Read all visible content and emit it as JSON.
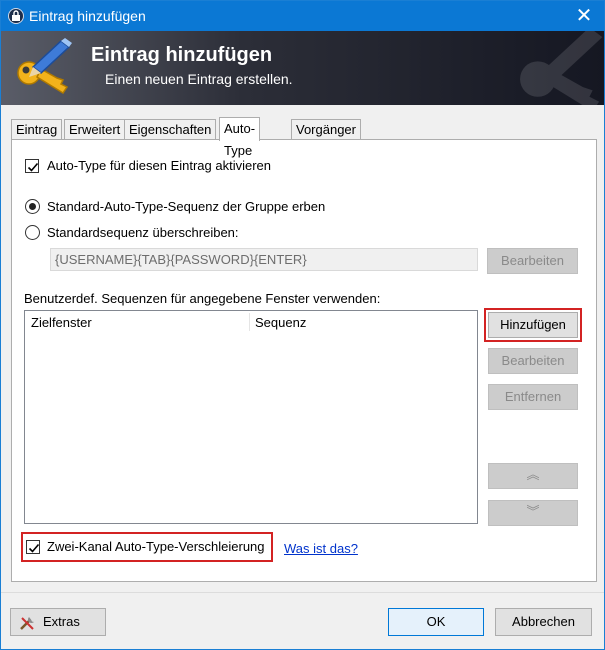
{
  "window": {
    "title": "Eintrag hinzufügen",
    "close_glyph": "✕"
  },
  "banner": {
    "title": "Eintrag hinzufügen",
    "subtitle": "Einen neuen Eintrag erstellen.",
    "icon": "key-pen-icon"
  },
  "tabs": [
    {
      "label": "Eintrag"
    },
    {
      "label": "Erweitert"
    },
    {
      "label": "Eigenschaften"
    },
    {
      "label": "Auto-Type"
    },
    {
      "label": "Vorgänger"
    }
  ],
  "active_tab": "Auto-Type",
  "autotype": {
    "enable_label": "Auto-Type für diesen Eintrag aktivieren",
    "enable_checked": true,
    "inherit_label": "Standard-Auto-Type-Sequenz der Gruppe erben",
    "inherit_selected": true,
    "override_label": "Standardsequenz überschreiben:",
    "override_selected": false,
    "sequence_value": "{USERNAME}{TAB}{PASSWORD}{ENTER}",
    "edit_default_label": "Bearbeiten",
    "custom_label": "Benutzerdef. Sequenzen für angegebene Fenster verwenden:",
    "columns": [
      "Zielfenster",
      "Sequenz"
    ],
    "add_label": "Hinzufügen",
    "edit_label": "Bearbeiten",
    "remove_label": "Entfernen",
    "up_glyph": "︽",
    "down_glyph": "︾",
    "obfuscation_label": "Zwei-Kanal Auto-Type-Verschleierung",
    "obfuscation_checked": true,
    "help_link": "Was ist das?"
  },
  "footer": {
    "extras_label": "Extras",
    "ok_label": "OK",
    "cancel_label": "Abbrechen"
  },
  "colors": {
    "titlebar": "#0b78d4",
    "highlight": "#d32323",
    "link": "#0033cc"
  }
}
